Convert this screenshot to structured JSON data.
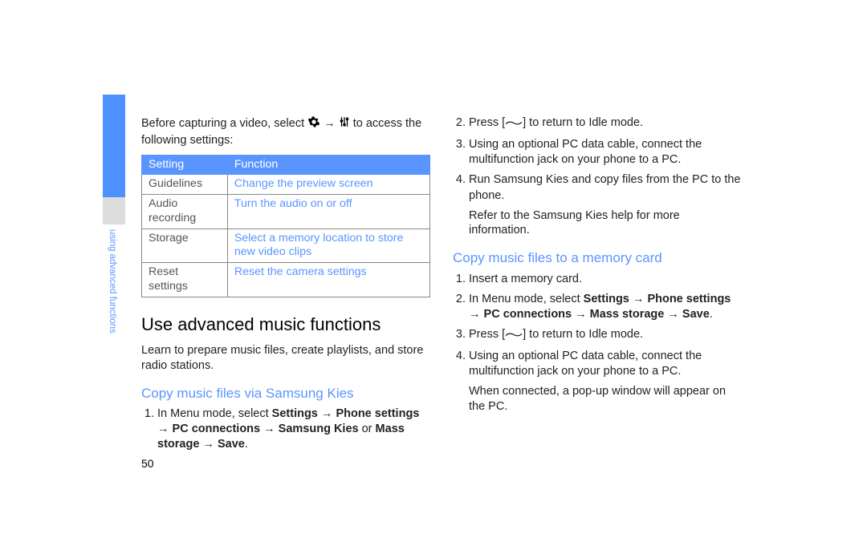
{
  "sidebar": {
    "label": "using advanced functions"
  },
  "left": {
    "intro_before": "Before capturing a video, select",
    "intro_after": "to access the following settings:",
    "table": {
      "head_setting": "Setting",
      "head_function": "Function",
      "rows": [
        {
          "setting": "Guidelines",
          "function": "Change the preview screen"
        },
        {
          "setting": "Audio recording",
          "function": "Turn the audio on or off"
        },
        {
          "setting": "Storage",
          "function": "Select a memory location to store new video clips"
        },
        {
          "setting": "Reset settings",
          "function": "Reset the camera settings"
        }
      ]
    },
    "h1": "Use advanced music functions",
    "h1_sub": "Learn to prepare music files, create playlists, and store radio stations.",
    "h2": "Copy music files via Samsung Kies",
    "list1_prefix": "In Menu mode, select ",
    "list1_bold1": "Settings",
    "list1_arrow": " → ",
    "list1_bold2": "Phone settings",
    "list1_bold3": "PC connections",
    "list1_bold4": "Samsung Kies",
    "list1_mid": " or ",
    "list1_bold5": "Mass storage",
    "list1_bold6": "Save",
    "list1_end": "."
  },
  "right": {
    "list2_a": "Press [",
    "list2_b": "] to return to Idle mode.",
    "list3": "Using an optional PC data cable, connect the multifunction jack on your phone to a PC.",
    "list4": "Run Samsung Kies and copy files from the PC to the phone.",
    "refer": "Refer to the Samsung Kies help for more information.",
    "h2": "Copy music files to a memory card",
    "mc1": "Insert a memory card.",
    "mc2_prefix": "In Menu mode, select ",
    "mc2_bold1": "Settings",
    "mc2_arrow": " → ",
    "mc2_bold2": "Phone settings",
    "mc2_bold3": "PC connections",
    "mc2_bold4": "Mass storage",
    "mc2_arrow2": " → ",
    "mc2_bold5": "Save",
    "mc2_end": ".",
    "mc3_a": "Press [",
    "mc3_b": "] to return to Idle mode.",
    "mc4": "Using an optional PC data cable, connect the multifunction jack on your phone to a PC.",
    "mc_note": "When connected, a pop-up window will appear on the PC."
  },
  "pagenum": "50"
}
